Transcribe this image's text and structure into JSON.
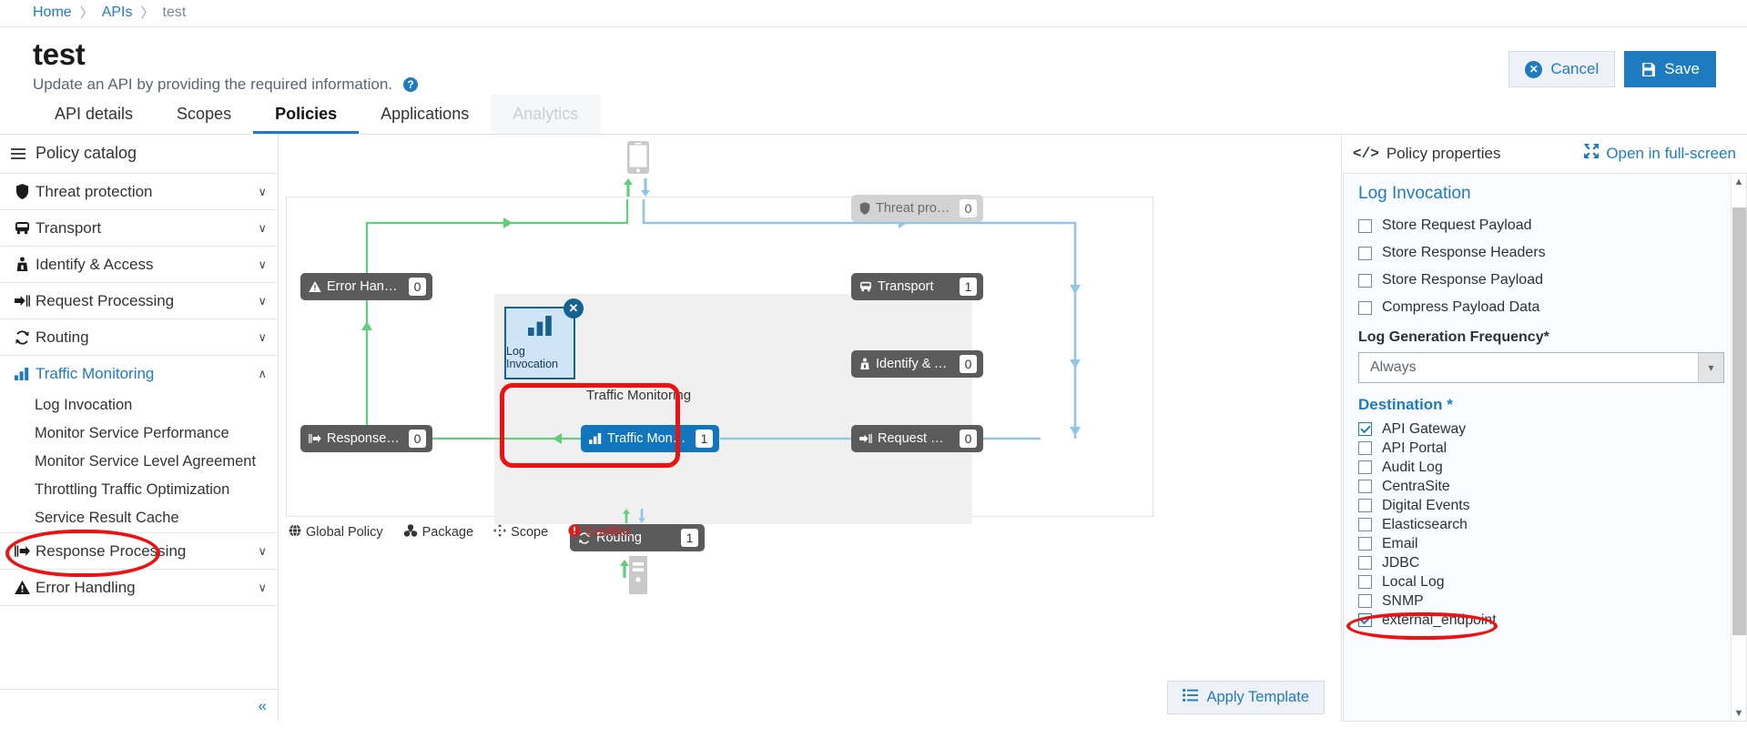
{
  "breadcrumb": {
    "home": "Home",
    "apis": "APIs",
    "current": "test",
    "separator": "〉"
  },
  "header": {
    "title": "test",
    "subtitle": "Update an API by providing the required information.",
    "help_glyph": "?",
    "cancel_label": "Cancel",
    "cancel_glyph": "✕",
    "save_label": "Save"
  },
  "tabs": [
    {
      "label": "API details",
      "state": "normal"
    },
    {
      "label": "Scopes",
      "state": "normal"
    },
    {
      "label": "Policies",
      "state": "active"
    },
    {
      "label": "Applications",
      "state": "normal"
    },
    {
      "label": "Analytics",
      "state": "disabled"
    }
  ],
  "catalog": {
    "title": "Policy catalog",
    "collapse_glyph": "«",
    "groups": [
      {
        "label": "Threat protection",
        "icon": "shield-icon",
        "expanded": false,
        "chevron": "∨",
        "items": []
      },
      {
        "label": "Transport",
        "icon": "bus-icon",
        "expanded": false,
        "chevron": "∨",
        "items": []
      },
      {
        "label": "Identify & Access",
        "icon": "lock-person-icon",
        "expanded": false,
        "chevron": "∨",
        "items": []
      },
      {
        "label": "Request Processing",
        "icon": "arrow-into-icon",
        "expanded": false,
        "chevron": "∨",
        "items": []
      },
      {
        "label": "Routing",
        "icon": "refresh-icon",
        "expanded": false,
        "chevron": "∨",
        "items": []
      },
      {
        "label": "Traffic Monitoring",
        "icon": "bar-chart-icon",
        "expanded": true,
        "chevron": "∧",
        "items": [
          "Log Invocation",
          "Monitor Service Performance",
          "Monitor Service Level Agreement",
          "Throttling Traffic Optimization",
          "Service Result Cache"
        ]
      },
      {
        "label": "Response Processing",
        "icon": "arrow-out-icon",
        "expanded": false,
        "chevron": "∨",
        "items": []
      },
      {
        "label": "Error Handling",
        "icon": "warning-icon",
        "expanded": false,
        "chevron": "∨",
        "items": []
      }
    ]
  },
  "canvas": {
    "policy_card": {
      "label": "Log Invocation",
      "icon": "bar-chart-icon",
      "close_glyph": "✕"
    },
    "group_label": "Traffic Monitoring",
    "nodes": [
      {
        "id": "threat-protection",
        "label": "Threat protection",
        "count": "0",
        "icon": "shield-icon",
        "style": "muted"
      },
      {
        "id": "transport",
        "label": "Transport",
        "count": "1",
        "icon": "bus-icon",
        "style": "dark"
      },
      {
        "id": "identify-access",
        "label": "Identify & Access",
        "count": "0",
        "icon": "lock-person-icon",
        "style": "dark"
      },
      {
        "id": "request-processing",
        "label": "Request Processi...",
        "count": "0",
        "icon": "arrow-into-icon",
        "style": "dark"
      },
      {
        "id": "error-handling",
        "label": "Error Handling",
        "count": "0",
        "icon": "warning-icon",
        "style": "dark"
      },
      {
        "id": "response-processing",
        "label": "Response Proces...",
        "count": "0",
        "icon": "arrow-out-icon",
        "style": "dark"
      },
      {
        "id": "traffic-monitoring",
        "label": "Traffic Monitoring",
        "count": "1",
        "icon": "bar-chart-icon",
        "style": "accent"
      },
      {
        "id": "routing",
        "label": "Routing",
        "count": "1",
        "icon": "refresh-icon",
        "style": "dark"
      }
    ],
    "legend": [
      {
        "label": "Global Policy",
        "icon": "globe-icon"
      },
      {
        "label": "Package",
        "icon": "package-icon"
      },
      {
        "label": "Scope",
        "icon": "scope-icon"
      },
      {
        "label": "Conflict",
        "icon": "conflict-icon"
      }
    ],
    "apply_template_label": "Apply Template"
  },
  "properties": {
    "header": "Policy properties",
    "fullscreen_label": "Open in full-screen",
    "code_glyph": "</>",
    "policy_title": "Log Invocation",
    "options": [
      {
        "label": "Store Request Payload",
        "checked": false
      },
      {
        "label": "Store Response Headers",
        "checked": false
      },
      {
        "label": "Store Response Payload",
        "checked": false
      },
      {
        "label": "Compress Payload Data",
        "checked": false
      }
    ],
    "frequency_label": "Log Generation Frequency*",
    "frequency_value": "Always",
    "destination_label": "Destination *",
    "destinations": [
      {
        "label": "API Gateway",
        "checked": true
      },
      {
        "label": "API Portal",
        "checked": false
      },
      {
        "label": "Audit Log",
        "checked": false
      },
      {
        "label": "CentraSite",
        "checked": false
      },
      {
        "label": "Digital Events",
        "checked": false
      },
      {
        "label": "Elasticsearch",
        "checked": false
      },
      {
        "label": "Email",
        "checked": false
      },
      {
        "label": "JDBC",
        "checked": false
      },
      {
        "label": "Local Log",
        "checked": false
      },
      {
        "label": "SNMP",
        "checked": false
      },
      {
        "label": "external_endpoint",
        "checked": true
      }
    ]
  },
  "colors": {
    "accent": "#1f7bbf",
    "annotation": "#ee1111",
    "request_flow": "#92c5ea",
    "response_flow": "#5ed07a",
    "node_dark": "#5b5b5b"
  }
}
